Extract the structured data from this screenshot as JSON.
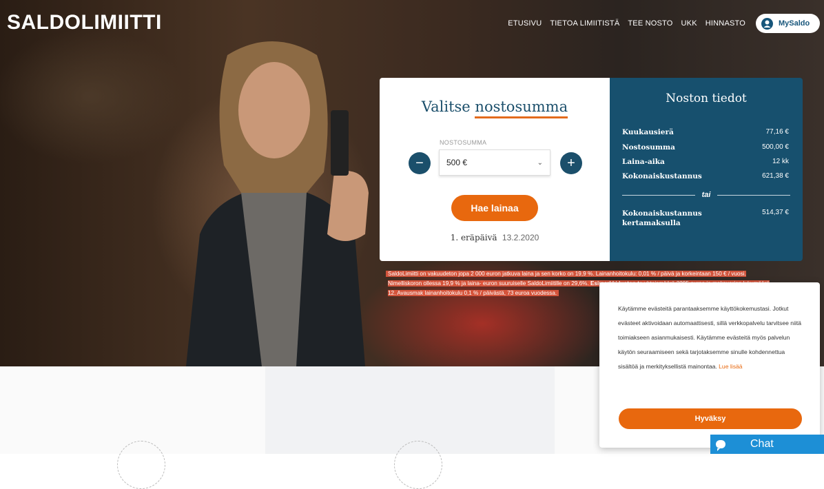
{
  "brand": {
    "logo_bold": "SALDO",
    "logo_thin": "LIMIITTI"
  },
  "nav": {
    "items": [
      "ETUSIVU",
      "TIETOA LIMIITISTÄ",
      "TEE NOSTO",
      "UKK",
      "HINNASTO"
    ],
    "account": "MySaldo"
  },
  "calculator": {
    "title_plain": "Valitse",
    "title_underlined": "nostosumma",
    "amount_label": "NOSTOSUMMA",
    "amount_value": "500 €",
    "minus": "−",
    "plus": "+",
    "apply_label": "Hae lainaa",
    "due_label": "1. eräpäivä",
    "due_date": "13.2.2020"
  },
  "details": {
    "title": "Noston tiedot",
    "rows": [
      {
        "label": "Kuukausierä",
        "value": "77,16 €"
      },
      {
        "label": "Nostosumma",
        "value": "500,00 €"
      },
      {
        "label": "Laina-aika",
        "value": "12 kk"
      },
      {
        "label": "Kokonaiskustannus",
        "value": "621,38 €"
      }
    ],
    "or_label": "tai",
    "alt_label": "Kokonaiskustannus kertamaksulla",
    "alt_value": "514,37 €"
  },
  "disclaimer": {
    "part1": "SaldoLimiitti on vakuudeton jopa 2 000 euron jatkuva laina ja sen korko on 19,9 %. Lainanhoitokulu: 0,01 % / päivä ja korkeintaan 150 € / vuosi. Nimelliskoron ollessa 19,9 % ja laina-",
    "part2": "euron suuruiselle SaldoLimiitille on 29,6%.",
    "bold": "Esimerkki luoton ta",
    "part3": "yhteismäärä 2295 euroa ja maksuerien lukumäärä 12. Avausmak",
    "part4": "lainanhoitokulu 0,1 % / päivästä, 73 euroa vuodessa."
  },
  "cookie": {
    "text": "Käytämme evästeitä parantaaksemme käyttökokemustasi. Jotkut evästeet aktivoidaan automaattisesti, sillä verkkopalvelu tarvitsee niitä toimiakseen asianmukaisesti. Käytämme evästeitä myös palvelun käytön seuraamiseen sekä tarjotaksemme sinulle kohdennettua sisältöä ja merkityksellistä mainontaa.",
    "read_more": "Lue lisää",
    "accept": "Hyväksy"
  },
  "chat": {
    "label": "Chat"
  },
  "colors": {
    "primary": "#17506e",
    "accent": "#e8680e",
    "chat": "#1d8fd6"
  }
}
